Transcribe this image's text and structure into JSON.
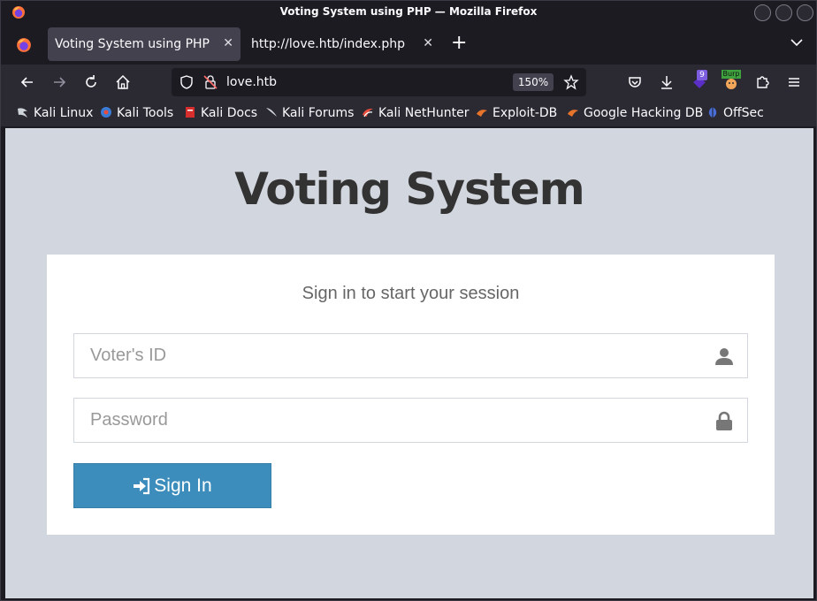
{
  "window": {
    "title": "Voting System using PHP — Mozilla Firefox"
  },
  "tabs": [
    {
      "label": "Voting System using PHP",
      "active": true
    },
    {
      "label": "http://love.htb/index.php",
      "active": false
    }
  ],
  "urlbar": {
    "url": "love.htb",
    "zoom": "150%"
  },
  "toolbar": {
    "extension_badge": "9",
    "burp_label": "Burp"
  },
  "bookmarks": [
    {
      "label": "Kali Linux",
      "icon": "kali-dragon-icon"
    },
    {
      "label": "Kali Tools",
      "icon": "kali-tools-icon"
    },
    {
      "label": "Kali Docs",
      "icon": "kali-docs-icon"
    },
    {
      "label": "Kali Forums",
      "icon": "kali-forums-icon"
    },
    {
      "label": "Kali NetHunter",
      "icon": "nethunter-icon"
    },
    {
      "label": "Exploit-DB",
      "icon": "exploit-db-icon"
    },
    {
      "label": "Google Hacking DB",
      "icon": "ghdb-icon"
    },
    {
      "label": "OffSec",
      "icon": "offsec-icon"
    }
  ],
  "page": {
    "title": "Voting System",
    "subtitle": "Sign in to start your session",
    "voter_id_placeholder": "Voter's ID",
    "password_placeholder": "Password",
    "signin_label": "Sign In"
  },
  "colors": {
    "page_background": "#d2d6de",
    "button_primary": "#3c8dbc",
    "browser_chrome": "#2b2a33"
  }
}
